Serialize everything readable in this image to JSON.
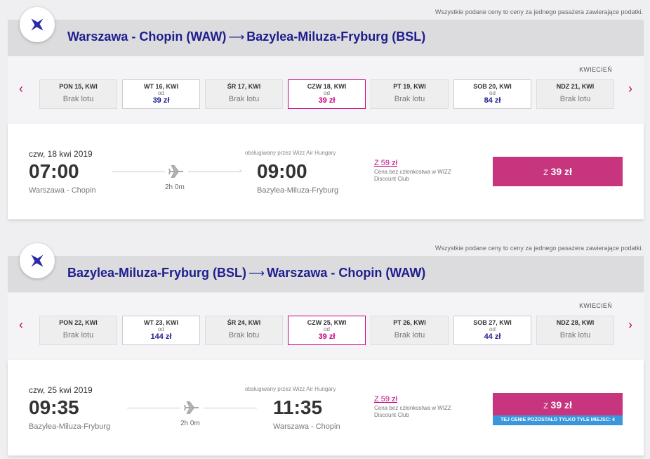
{
  "disclaimer": "Wszystkie podane ceny to ceny za jednego pasażera zawierające podatki.",
  "colors": {
    "brand": "#1e1e8e",
    "accent": "#c6007e",
    "badge": "#3a97db"
  },
  "outbound": {
    "route": {
      "origin": "Warszawa - Chopin (WAW)",
      "arrow": "⟶",
      "destination": "Bazylea-Miluza-Fryburg (BSL)"
    },
    "month": "KWIECIEŃ",
    "days": [
      {
        "name": "PON 15, KWI",
        "od": "",
        "price": "",
        "status": "Brak lotu"
      },
      {
        "name": "WT 16, KWI",
        "od": "od",
        "price": "39 zł",
        "status": ""
      },
      {
        "name": "ŚR 17, KWI",
        "od": "",
        "price": "",
        "status": "Brak lotu"
      },
      {
        "name": "CZW 18, KWI",
        "od": "od",
        "price": "39 zł",
        "status": ""
      },
      {
        "name": "PT 19, KWI",
        "od": "",
        "price": "",
        "status": "Brak lotu"
      },
      {
        "name": "SOB 20, KWI",
        "od": "od",
        "price": "84 zł",
        "status": ""
      },
      {
        "name": "NDZ 21, KWI",
        "od": "",
        "price": "",
        "status": "Brak lotu"
      }
    ],
    "flight": {
      "date": "czw, 18 kwi 2019",
      "dep_time": "07:00",
      "dep_city": "Warszawa - Chopin",
      "arr_time": "09:00",
      "arr_city": "Bazylea-Miluza-Fryburg",
      "duration": "2h 0m",
      "operator": "obsługiwany przez Wizz Air Hungary",
      "member_price": "Z 59 zł",
      "member_note": "Cena bez członkostwa w WIZZ Discount Club",
      "price_prefix": "Z",
      "price": "39 zł",
      "seats_left": ""
    }
  },
  "return": {
    "route": {
      "origin": "Bazylea-Miluza-Fryburg (BSL)",
      "arrow": "⟶",
      "destination": "Warszawa - Chopin (WAW)"
    },
    "month": "KWIECIEŃ",
    "days": [
      {
        "name": "PON 22, KWI",
        "od": "",
        "price": "",
        "status": "Brak lotu"
      },
      {
        "name": "WT 23, KWI",
        "od": "od",
        "price": "144 zł",
        "status": ""
      },
      {
        "name": "ŚR 24, KWI",
        "od": "",
        "price": "",
        "status": "Brak lotu"
      },
      {
        "name": "CZW 25, KWI",
        "od": "od",
        "price": "39 zł",
        "status": ""
      },
      {
        "name": "PT 26, KWI",
        "od": "",
        "price": "",
        "status": "Brak lotu"
      },
      {
        "name": "SOB 27, KWI",
        "od": "od",
        "price": "44 zł",
        "status": ""
      },
      {
        "name": "NDZ 28, KWI",
        "od": "",
        "price": "",
        "status": "Brak lotu"
      }
    ],
    "flight": {
      "date": "czw, 25 kwi 2019",
      "dep_time": "09:35",
      "dep_city": "Bazylea-Miluza-Fryburg",
      "arr_time": "11:35",
      "arr_city": "Warszawa - Chopin",
      "duration": "2h 0m",
      "operator": "obsługiwany przez Wizz Air Hungary",
      "member_price": "Z 59 zł",
      "member_note": "Cena bez członkostwa w WIZZ Discount Club",
      "price_prefix": "Z",
      "price": "39 zł",
      "seats_left": "TEJ CENIE POZOSTAŁO TYLKO TYLE MIEJSC: 4"
    }
  }
}
